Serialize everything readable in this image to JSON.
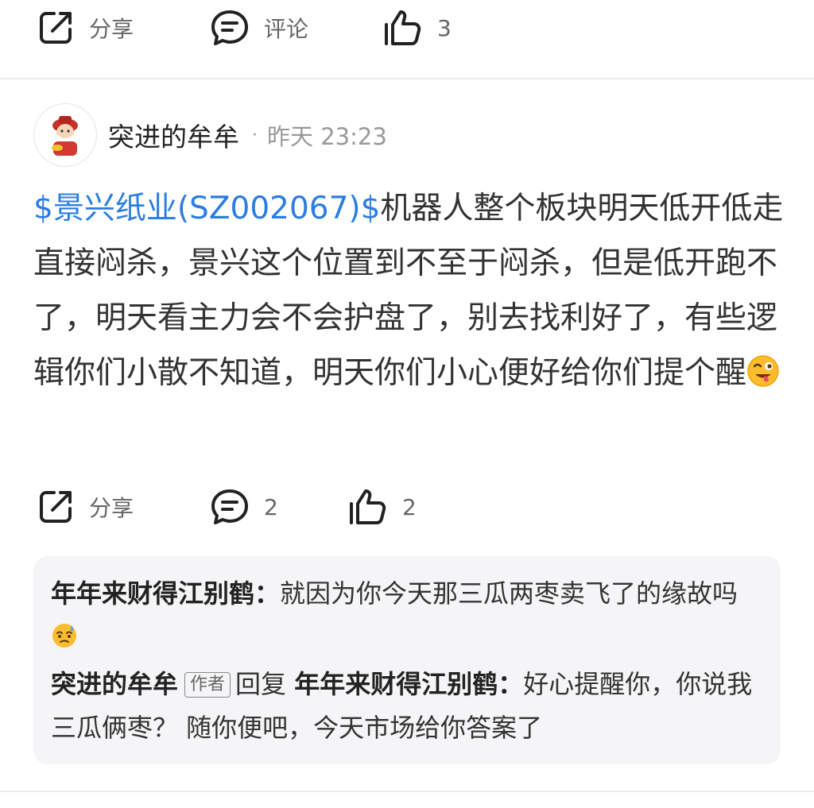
{
  "top_actions": {
    "share_label": "分享",
    "comment_label": "评论",
    "like_count": "3"
  },
  "post": {
    "username": "突进的牟牟",
    "dot": "·",
    "time": "昨天 23:23",
    "stock_link": "$景兴纸业(SZ002067)$",
    "body_text": "机器人整个板块明天低开低走直接闷杀，景兴这个位置到不至于闷杀，但是低开跑不了，明天看主力会不会护盘了，别去找利好了，有些逻辑你们小散不知道，明天你们小心便好给你们提个醒",
    "emoji": "winking-face-with-tongue"
  },
  "post_actions": {
    "share_label": "分享",
    "comment_count": "2",
    "like_count": "2"
  },
  "comments": [
    {
      "author": "年年来财得江别鹤：",
      "text": "就因为你今天那三瓜两枣卖飞了的缘故吗",
      "emoji": "face-with-sweat"
    },
    {
      "author": "突进的牟牟",
      "tag": "作者",
      "reply_word": "回复",
      "reply_to": "年年来财得江别鹤：",
      "text": "好心提醒你，你说我三瓜俩枣？ 随你便吧，今天市场给你答案了"
    }
  ],
  "colors": {
    "link": "#2d7de1",
    "text": "#333333",
    "muted": "#999999",
    "comment_bg": "#f5f5f7"
  }
}
